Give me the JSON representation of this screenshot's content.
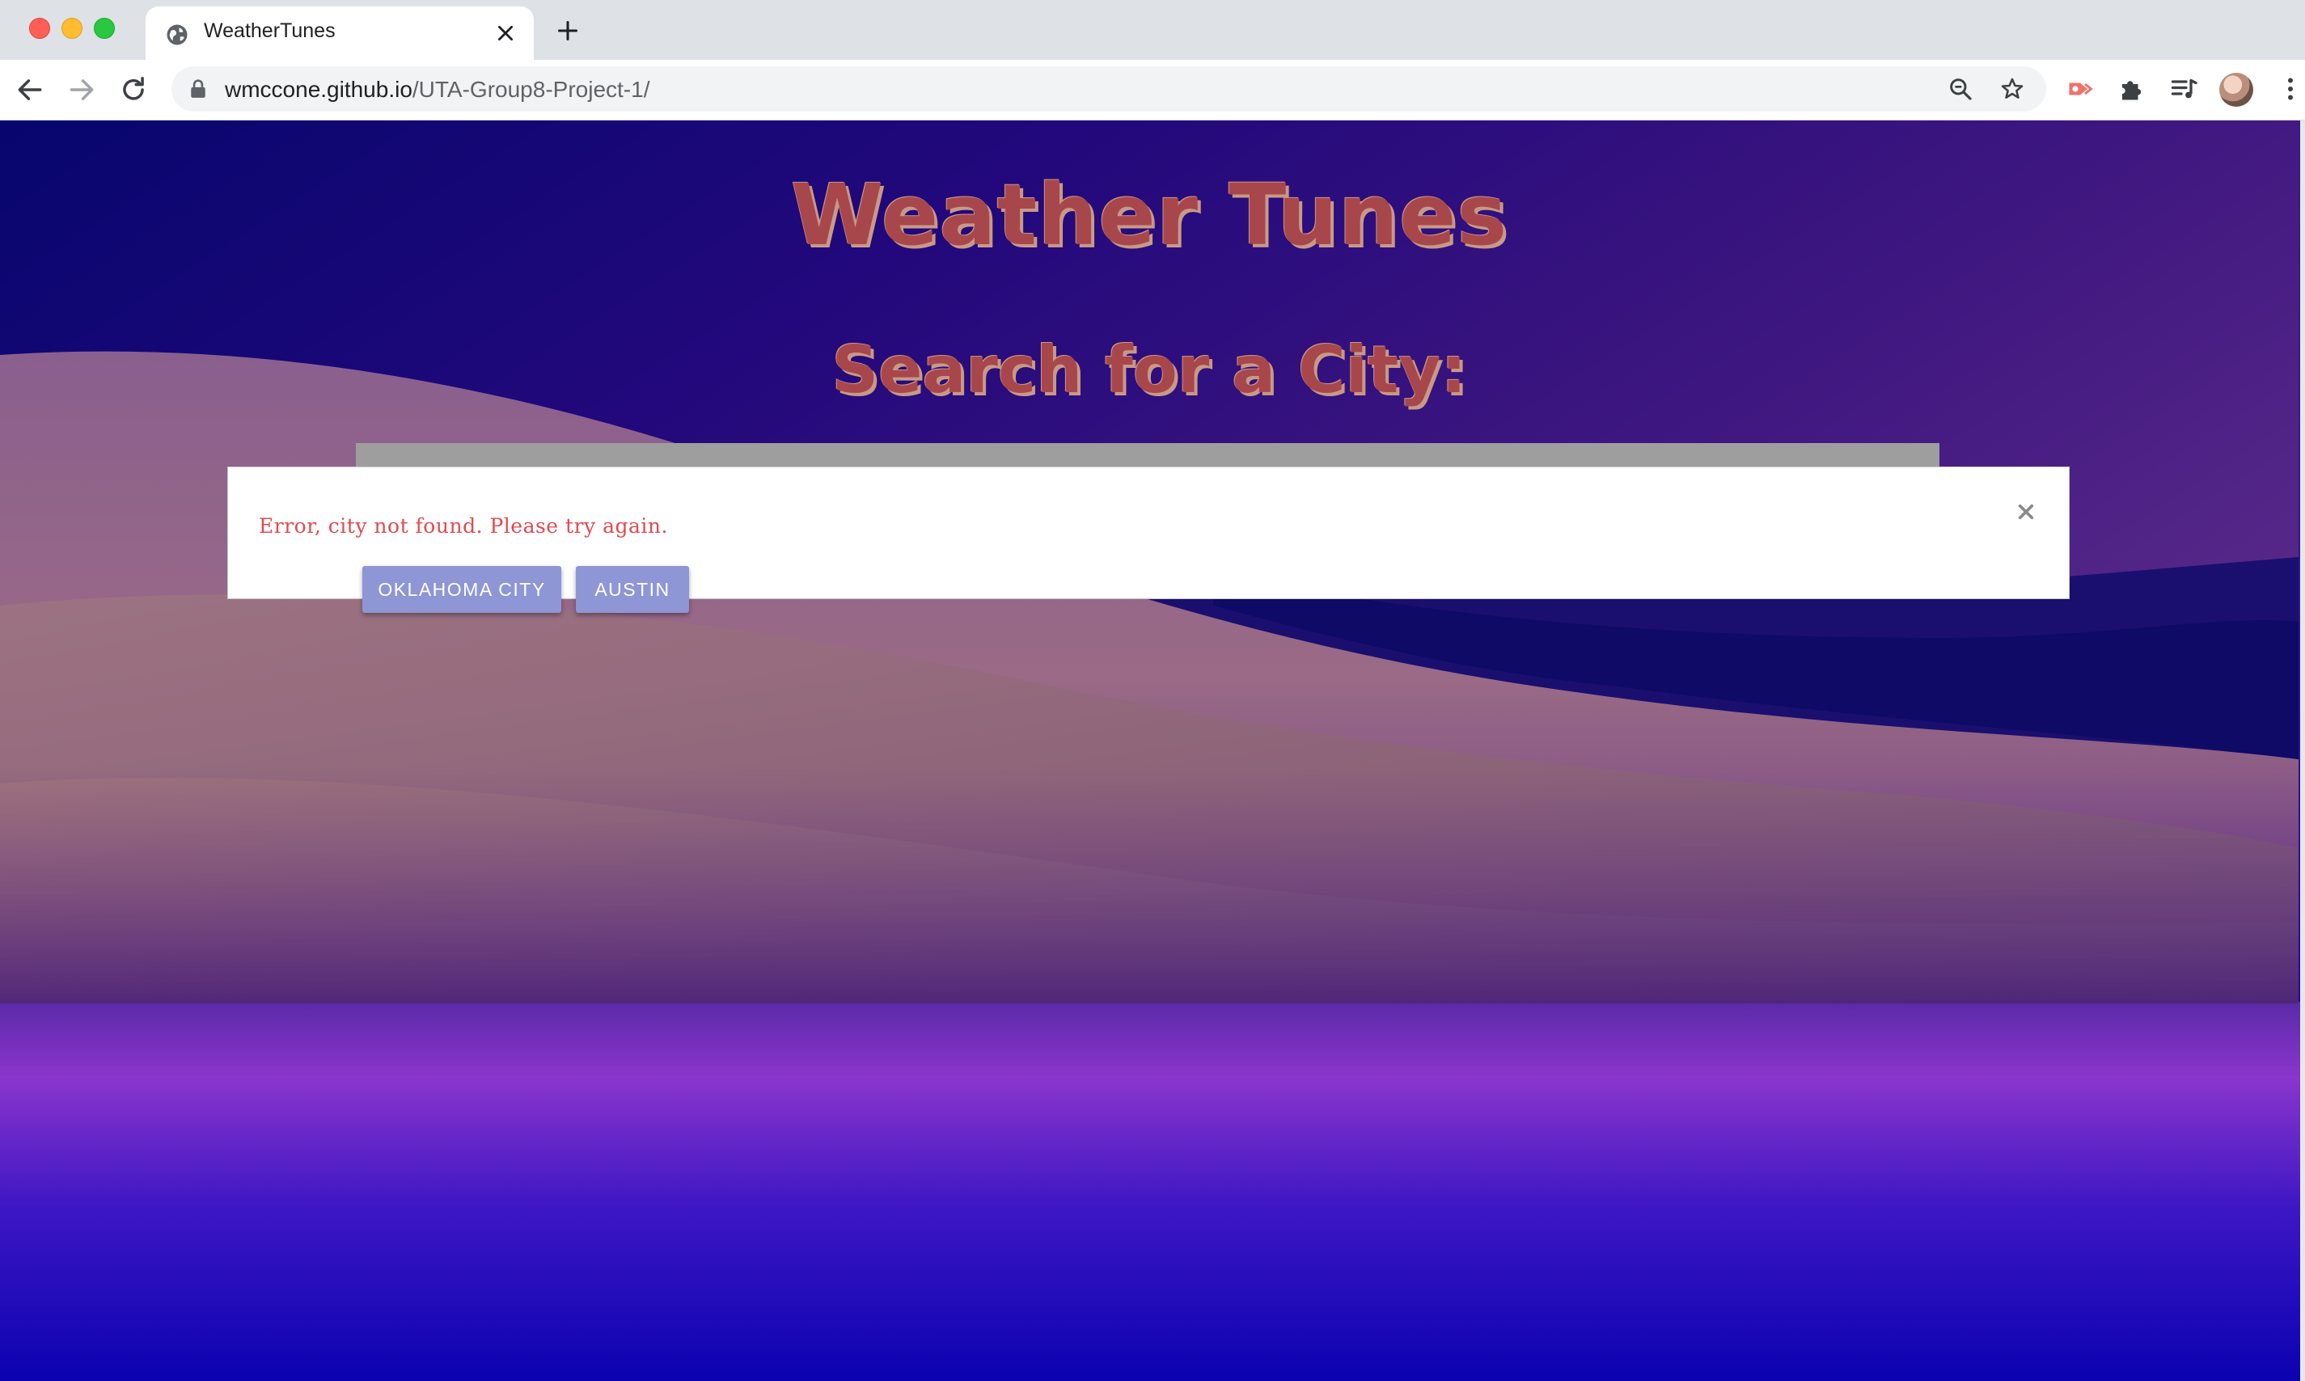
{
  "browser": {
    "tab_title": "WeatherTunes",
    "url_host": "wmccone.github.io",
    "url_path": "/UTA-Group8-Project-1/"
  },
  "page": {
    "title": "Weather Tunes",
    "subtitle": "Search for a City:"
  },
  "modal": {
    "error_message": "Error, city not found. Please try again.",
    "close_label": "×"
  },
  "history": {
    "buttons": [
      "OKLAHOMA CITY",
      "AUSTIN"
    ]
  },
  "colors": {
    "title": "#a8474b",
    "error": "#e24a50",
    "city_button": "#8e96d6"
  }
}
